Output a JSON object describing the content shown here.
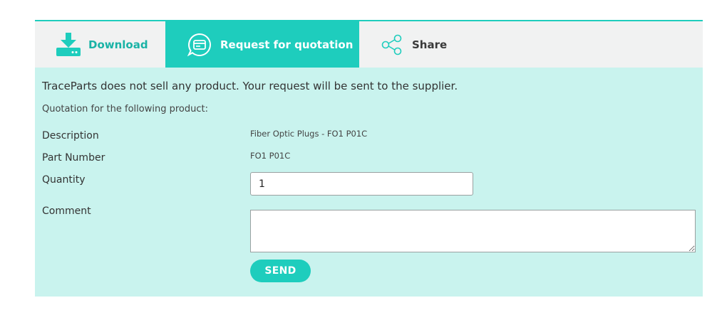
{
  "tabs": {
    "download": {
      "label": "Download",
      "icon": "download-icon"
    },
    "rfq": {
      "label": "Request for quotation",
      "icon": "quotation-chat-icon",
      "active": true
    },
    "share": {
      "label": "Share",
      "icon": "share-icon"
    }
  },
  "form": {
    "notice": "TraceParts does not sell any product. Your request will be sent to the supplier.",
    "intro": "Quotation for the following product:",
    "description_label": "Description",
    "description_value": "Fiber Optic Plugs - FO1 P01C",
    "part_number_label": "Part Number",
    "part_number_value": "FO1 P01C",
    "quantity_label": "Quantity",
    "quantity_value": "1",
    "comment_label": "Comment",
    "comment_value": "",
    "send_label": "SEND"
  },
  "colors": {
    "accent": "#1ecdbd",
    "panel_background": "#c9f3ee",
    "tabbar_background": "#f1f2f2"
  }
}
